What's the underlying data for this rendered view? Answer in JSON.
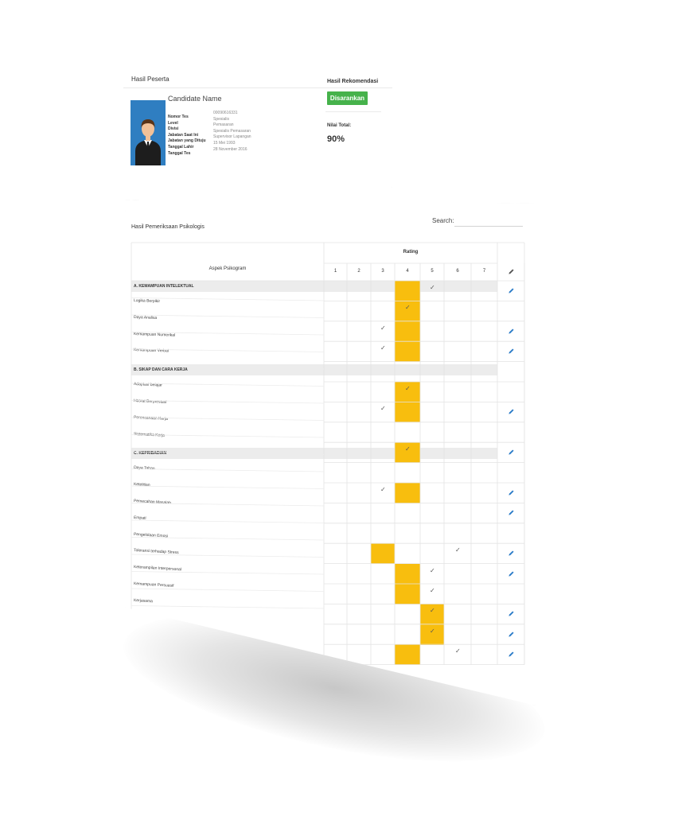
{
  "colors": {
    "accent_yellow": "#f8be0e",
    "recommend_green": "#46b24b",
    "photo_blue": "#2f7ec1",
    "edit_blue": "#2a7bc8"
  },
  "participant": {
    "title": "Hasil Peserta",
    "candidate_name": "Candidate Name",
    "fields": [
      {
        "label": "Nomor Tes",
        "value": "00090616331"
      },
      {
        "label": "Level",
        "value": "Spesialis"
      },
      {
        "label": "Divisi",
        "value": "Pemasaran"
      },
      {
        "label": "Jabatan Saat Ini",
        "value": "Spesialis Pemasaran"
      },
      {
        "label": "Jabatan yang Dituju",
        "value": "Supervisor Lapangan"
      },
      {
        "label": "Tanggal Lahir",
        "value": "15 Mei 1993"
      },
      {
        "label": "Tanggal Tes",
        "value": "28 November 2016"
      }
    ],
    "recommendation_label": "Hasil Rekomendasi",
    "recommendation_value": "Disarankan",
    "total_label": "Nilai Total:",
    "total_value": "90%"
  },
  "psychology": {
    "title": "Hasil Pemeriksaan Psikologis",
    "search_label": "Search:",
    "search_value": "",
    "aspect_header": "Aspek Psikogram",
    "rating_header": "Rating",
    "rating_levels": [
      "1",
      "2",
      "3",
      "4",
      "5",
      "6",
      "7"
    ],
    "edit_icon": "pencil-icon",
    "sections": [
      {
        "title": "A. KEMAMPUAN INTELEKTUAL",
        "items": [
          "Logika Berpikir",
          "Daya Analisa",
          "Kemampuan Numerikal",
          "Kemampuan Verbal"
        ]
      },
      {
        "title": "B. SIKAP DAN CARA KERJA",
        "items": [
          "Adaptasi belajar",
          "Hasrat Berprestasi",
          "Perencanaan Kerja",
          "Sistematika Kerja"
        ]
      },
      {
        "title": "C. KEPRIBADIAN",
        "items": [
          "Daya Tahan",
          "Ketelitian",
          "Pemecahan Masalah",
          "Empati",
          "Pengelolaan Emosi",
          "Toleransi terhadap Stress",
          "Keterampilan Interpersonal",
          "Kemampuan Persuasif",
          "Kerjasama"
        ]
      }
    ],
    "grid_rows": [
      {
        "highlight": 4,
        "check": 5
      },
      {
        "highlight": 4,
        "check": 4
      },
      {
        "highlight": 4,
        "check": 3
      },
      {
        "highlight": 4,
        "check": 3
      },
      {
        "highlight": null,
        "check": null
      },
      {
        "highlight": 4,
        "check": 4
      },
      {
        "highlight": 4,
        "check": 3
      },
      {
        "highlight": null,
        "check": null
      },
      {
        "highlight": 4,
        "check": 4
      },
      {
        "highlight": null,
        "check": null
      },
      {
        "highlight": 4,
        "check": 3
      },
      {
        "highlight": null,
        "check": null
      },
      {
        "highlight": null,
        "check": null
      },
      {
        "highlight": 3,
        "check": 6
      },
      {
        "highlight": 4,
        "check": 5
      },
      {
        "highlight": 4,
        "check": 5
      },
      {
        "highlight": 5,
        "check": 5
      },
      {
        "highlight": 5,
        "check": 5
      },
      {
        "highlight": 4,
        "check": 6
      }
    ],
    "edit_rows": [
      1,
      3,
      4,
      7,
      9,
      11,
      12,
      14,
      15,
      17,
      18,
      19
    ]
  }
}
